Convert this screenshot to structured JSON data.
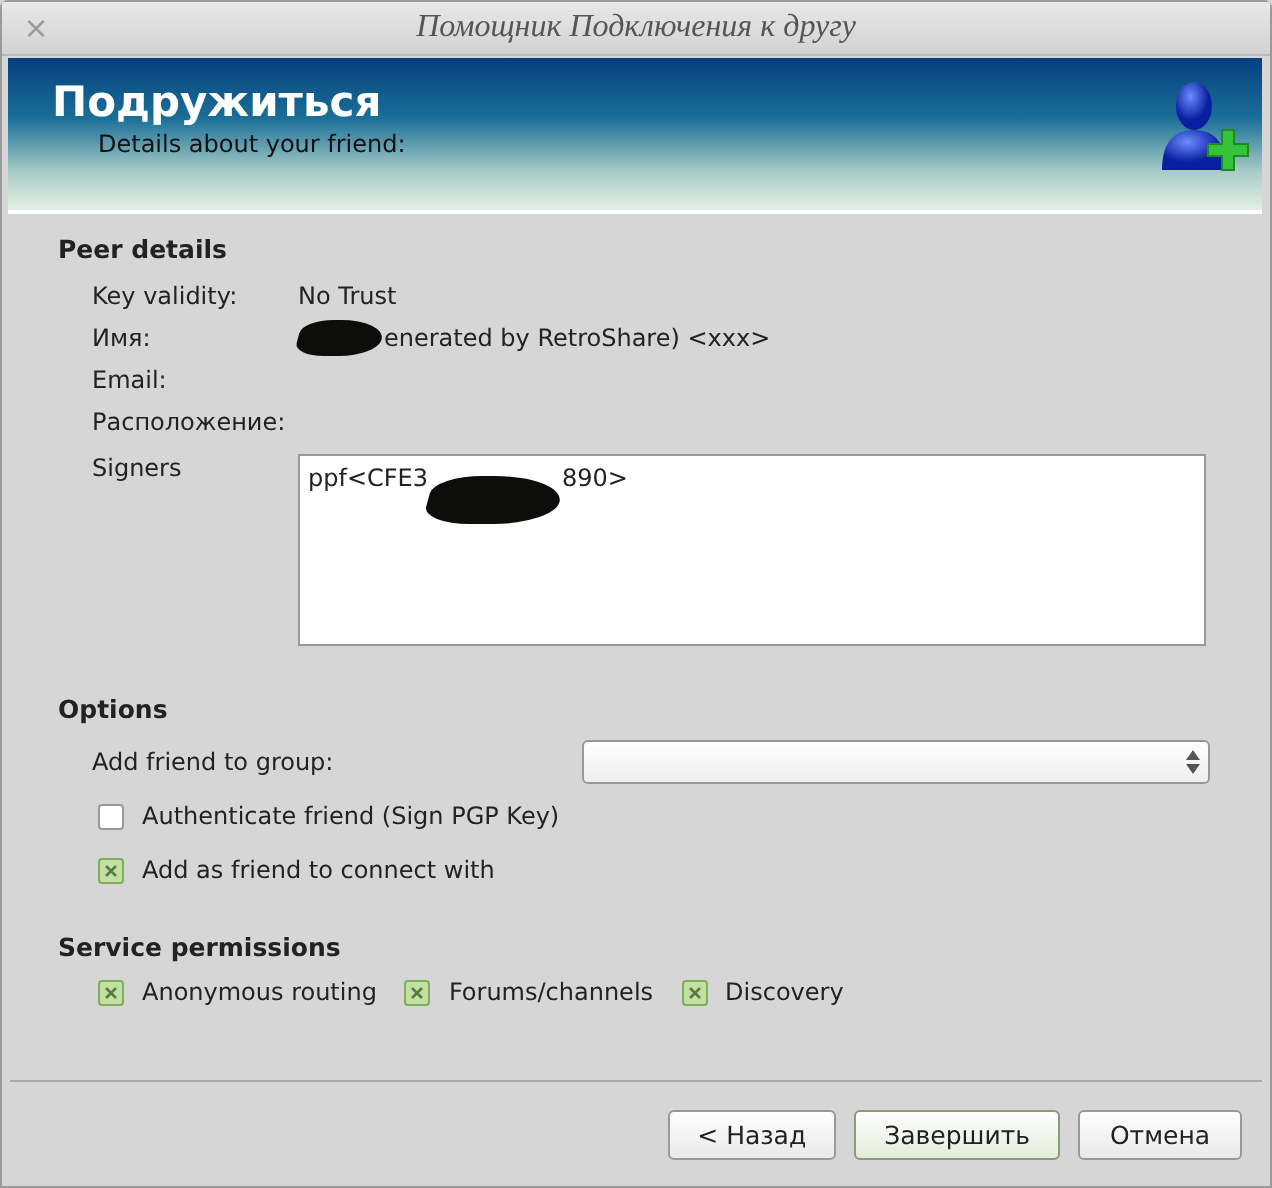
{
  "window": {
    "title": "Помощник Подключения к другу",
    "close": "×"
  },
  "banner": {
    "title": "Подружиться",
    "subtitle": "Details about your friend:"
  },
  "peer_details": {
    "heading": "Peer details",
    "rows": [
      {
        "label": "Key validity:",
        "value": "No Trust"
      },
      {
        "label": "Имя:",
        "redacted": true,
        "value": "enerated by RetroShare) <xxx>"
      },
      {
        "label": "Email:"
      },
      {
        "label": "Расположение:"
      }
    ],
    "signers": {
      "label": "Signers",
      "before": "ppf<CFE3",
      "after": "890>"
    }
  },
  "options": {
    "heading": "Options",
    "group_label": "Add friend to group:",
    "checks": [
      {
        "label": "Authenticate friend (Sign PGP Key)",
        "checked": false
      },
      {
        "label": "Add as friend to connect with",
        "checked": true
      }
    ]
  },
  "service_permissions": {
    "heading": "Service permissions",
    "checks": [
      {
        "label": "Anonymous routing",
        "checked": true
      },
      {
        "label": "Forums/channels",
        "checked": true
      },
      {
        "label": "Discovery",
        "checked": true
      }
    ]
  },
  "buttons": [
    {
      "label": "< Назад",
      "default": false
    },
    {
      "label": "Завершить",
      "default": true
    },
    {
      "label": "Отмена",
      "default": false
    }
  ]
}
